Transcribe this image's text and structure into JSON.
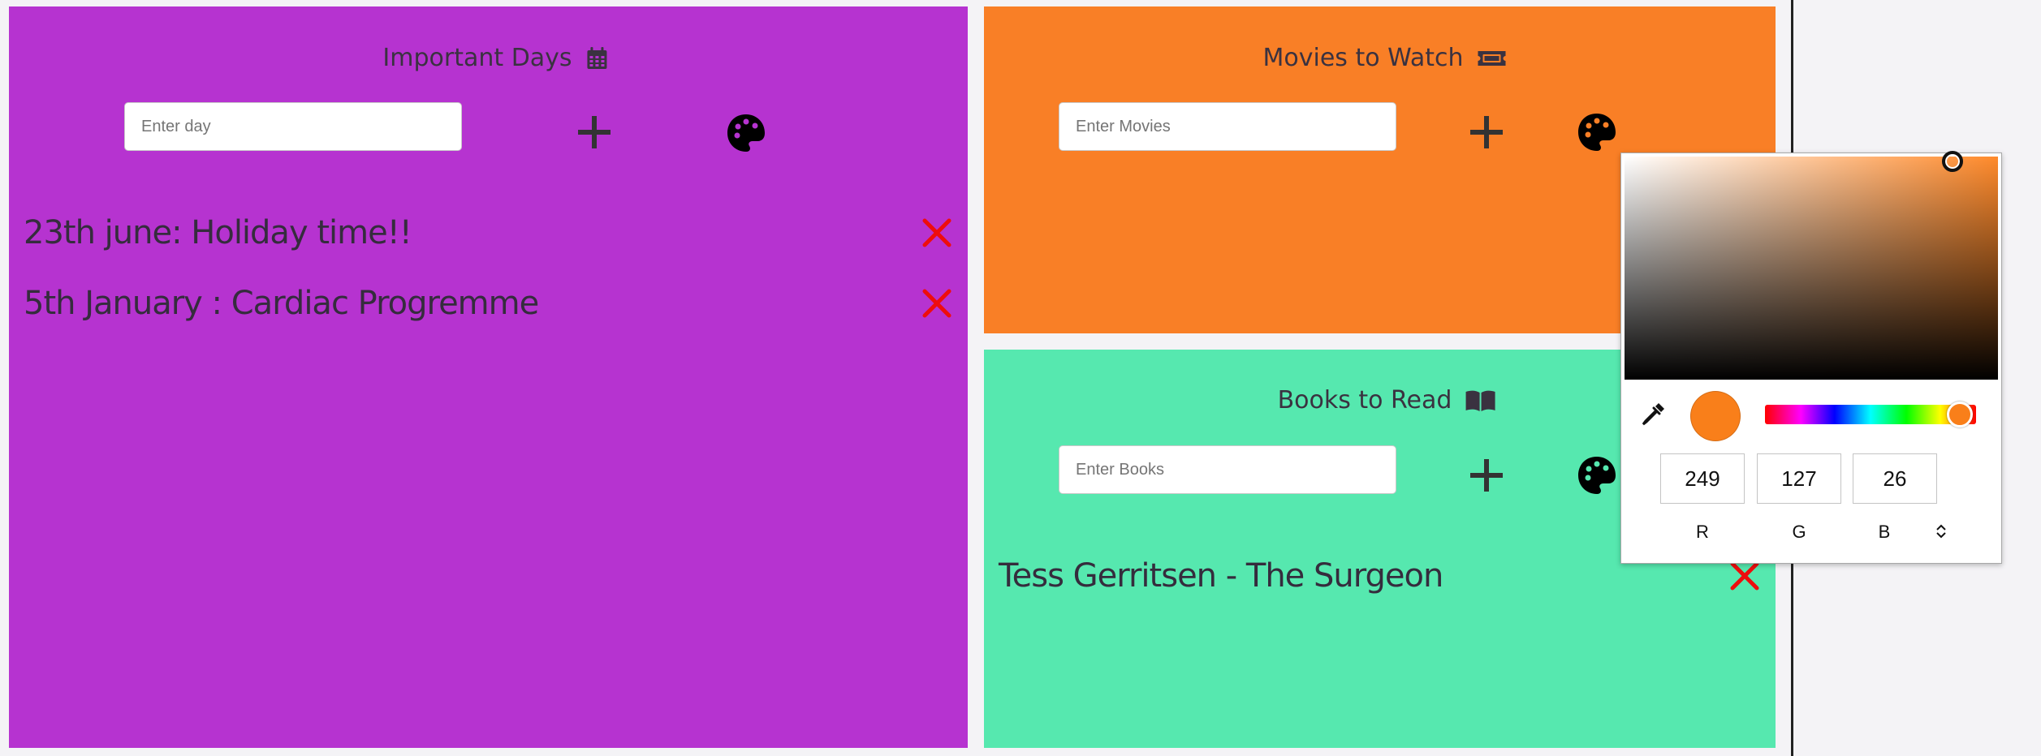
{
  "colors": {
    "days_bg": "#b633d0",
    "movies_bg": "#f97f26",
    "books_bg": "#56e8af",
    "delete_color": "#ee0d0d",
    "picker_color": "#f97f1a"
  },
  "panels": {
    "days": {
      "title": "Important Days",
      "title_icon": "calendar-icon",
      "input_placeholder": "Enter day",
      "items": [
        "23th june: Holiday time!!",
        "5th January : Cardiac Progremme"
      ]
    },
    "movies": {
      "title": "Movies to Watch",
      "title_icon": "ticket-icon",
      "input_placeholder": "Enter Movies",
      "items": []
    },
    "books": {
      "title": "Books to Read",
      "title_icon": "book-icon",
      "input_placeholder": "Enter Books",
      "items": [
        "Tess Gerritsen - The Surgeon"
      ]
    }
  },
  "color_picker": {
    "r": "249",
    "g": "127",
    "b": "26",
    "r_label": "R",
    "g_label": "G",
    "b_label": "B",
    "mode_icon": "up-down-chevron-icon",
    "eyedropper_icon": "eyedropper-icon"
  }
}
